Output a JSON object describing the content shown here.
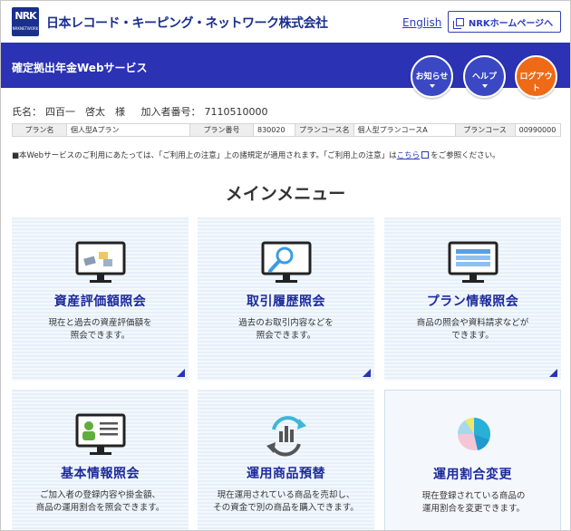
{
  "header": {
    "logo_text": "NRK",
    "logo_sub": "NRKNETWORK",
    "company": "日本レコード・キーピング・ネットワーク株式会社",
    "english_link": "English",
    "home_button": "NRKホームページへ"
  },
  "bluebar": {
    "service_name": "確定拠出年金Webサービス",
    "notice_label": "お知らせ",
    "help_label": "ヘルプ",
    "logout_label": "ログアウト"
  },
  "user": {
    "name_label": "氏名：",
    "name_value": "四百一　啓太　様",
    "id_label": "加入者番号：",
    "id_value": "7110510000"
  },
  "plan": {
    "plan_name_label": "プラン名",
    "plan_name_value": "個人型Aプラン",
    "plan_no_label": "プラン番号",
    "plan_no_value": "830020",
    "course_name_label": "プランコース名",
    "course_name_value": "個人型プランコースA",
    "course_label": "プランコース",
    "course_value": "00990000"
  },
  "notice": {
    "text_before": "■本Webサービスのご利用にあたっては、「ご利用上の注意」上の諸規定が適用されます。「ご利用上の注意」は",
    "link": "こちら",
    "text_after": "をご参照ください。"
  },
  "menu_title": "メインメニュー",
  "cards": [
    {
      "title": "資産評価額照会",
      "desc1": "現在と過去の資産評価額を",
      "desc2": "照会できます。",
      "icon": "asset-valuation-icon"
    },
    {
      "title": "取引履歴照会",
      "desc1": "過去のお取引内容などを",
      "desc2": "照会できます。",
      "icon": "transaction-search-icon"
    },
    {
      "title": "プラン情報照会",
      "desc1": "商品の照会や資料請求などが",
      "desc2": "できます。",
      "icon": "plan-info-icon"
    },
    {
      "title": "基本情報照会",
      "desc1": "ご加入者の登録内容や掛金額、",
      "desc2": "商品の運用割合を照会できます。",
      "icon": "member-info-icon"
    },
    {
      "title": "運用商品預替",
      "desc1": "現在運用されている商品を売却し、",
      "desc2": "その資金で別の商品を購入できます。",
      "icon": "product-switch-icon"
    },
    {
      "title": "運用割合変更",
      "desc1": "現在登録されている商品の",
      "desc2": "運用割合を変更できます。",
      "icon": "allocation-pie-icon"
    }
  ],
  "colors": {
    "brand_blue": "#2b32b4",
    "logout_orange": "#ef6a16",
    "title_blue": "#1d2a9c"
  }
}
